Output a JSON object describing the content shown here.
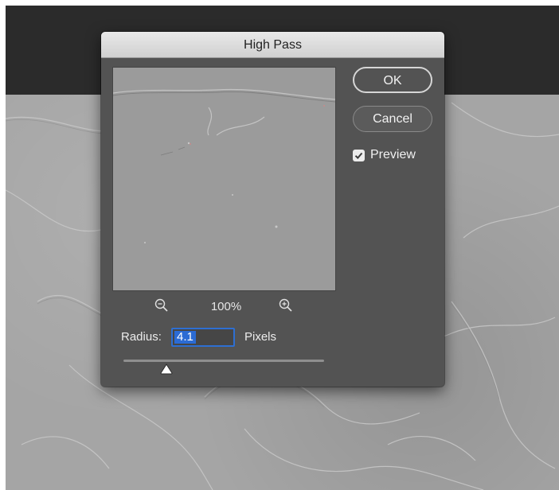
{
  "dialog": {
    "title": "High Pass",
    "ok_label": "OK",
    "cancel_label": "Cancel",
    "preview_label": "Preview",
    "preview_checked": true,
    "zoom_level": "100%",
    "radius_label": "Radius:",
    "radius_value": "4.1",
    "radius_unit": "Pixels",
    "slider_position_fraction": 0.21
  },
  "icons": {
    "zoom_out": "zoom-out-magnifier-icon",
    "zoom_in": "zoom-in-magnifier-icon",
    "checkbox": "checkmark-icon",
    "slider_thumb": "triangle-thumb-icon"
  },
  "colors": {
    "dialog_bg": "#535353",
    "titlebar": "#dcdcdc",
    "accent": "#2b6bd4",
    "workspace_dark": "#2b2b2b",
    "canvas_gray": "#a5a5a5"
  }
}
